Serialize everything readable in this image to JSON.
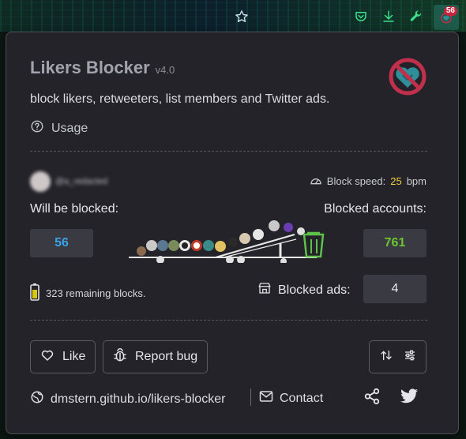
{
  "browser": {
    "icons": [
      "star-icon",
      "pocket-icon",
      "download-icon",
      "wrench-icon",
      "likers-blocker-extension-icon"
    ],
    "extension_badge": "56"
  },
  "header": {
    "title": "Likers Blocker",
    "version": "v4.0",
    "tagline": "block likers, retweeters, list members and Twitter ads.",
    "usage_label": "Usage"
  },
  "account": {
    "block_speed_label": "Block speed:",
    "block_speed_value": "25",
    "block_speed_unit": "bpm"
  },
  "stats": {
    "will_be_blocked_label": "Will be blocked:",
    "will_be_blocked_value": "56",
    "blocked_accounts_label": "Blocked accounts:",
    "blocked_accounts_value": "761",
    "remaining_text": "323 remaining blocks.",
    "blocked_ads_label": "Blocked ads:",
    "blocked_ads_value": "4"
  },
  "actions": {
    "like_label": "Like",
    "report_bug_label": "Report bug"
  },
  "footer": {
    "website_label": "dmstern.github.io/likers-blocker",
    "contact_label": "Contact"
  },
  "colors": {
    "panel_bg": "#232329",
    "will_be_blocked_value": "#3ba3e6",
    "blocked_accounts_value": "#6cc431",
    "block_speed_value": "#f2d33c",
    "logo_teal": "#2f8f98",
    "logo_ring": "#c0304b"
  }
}
